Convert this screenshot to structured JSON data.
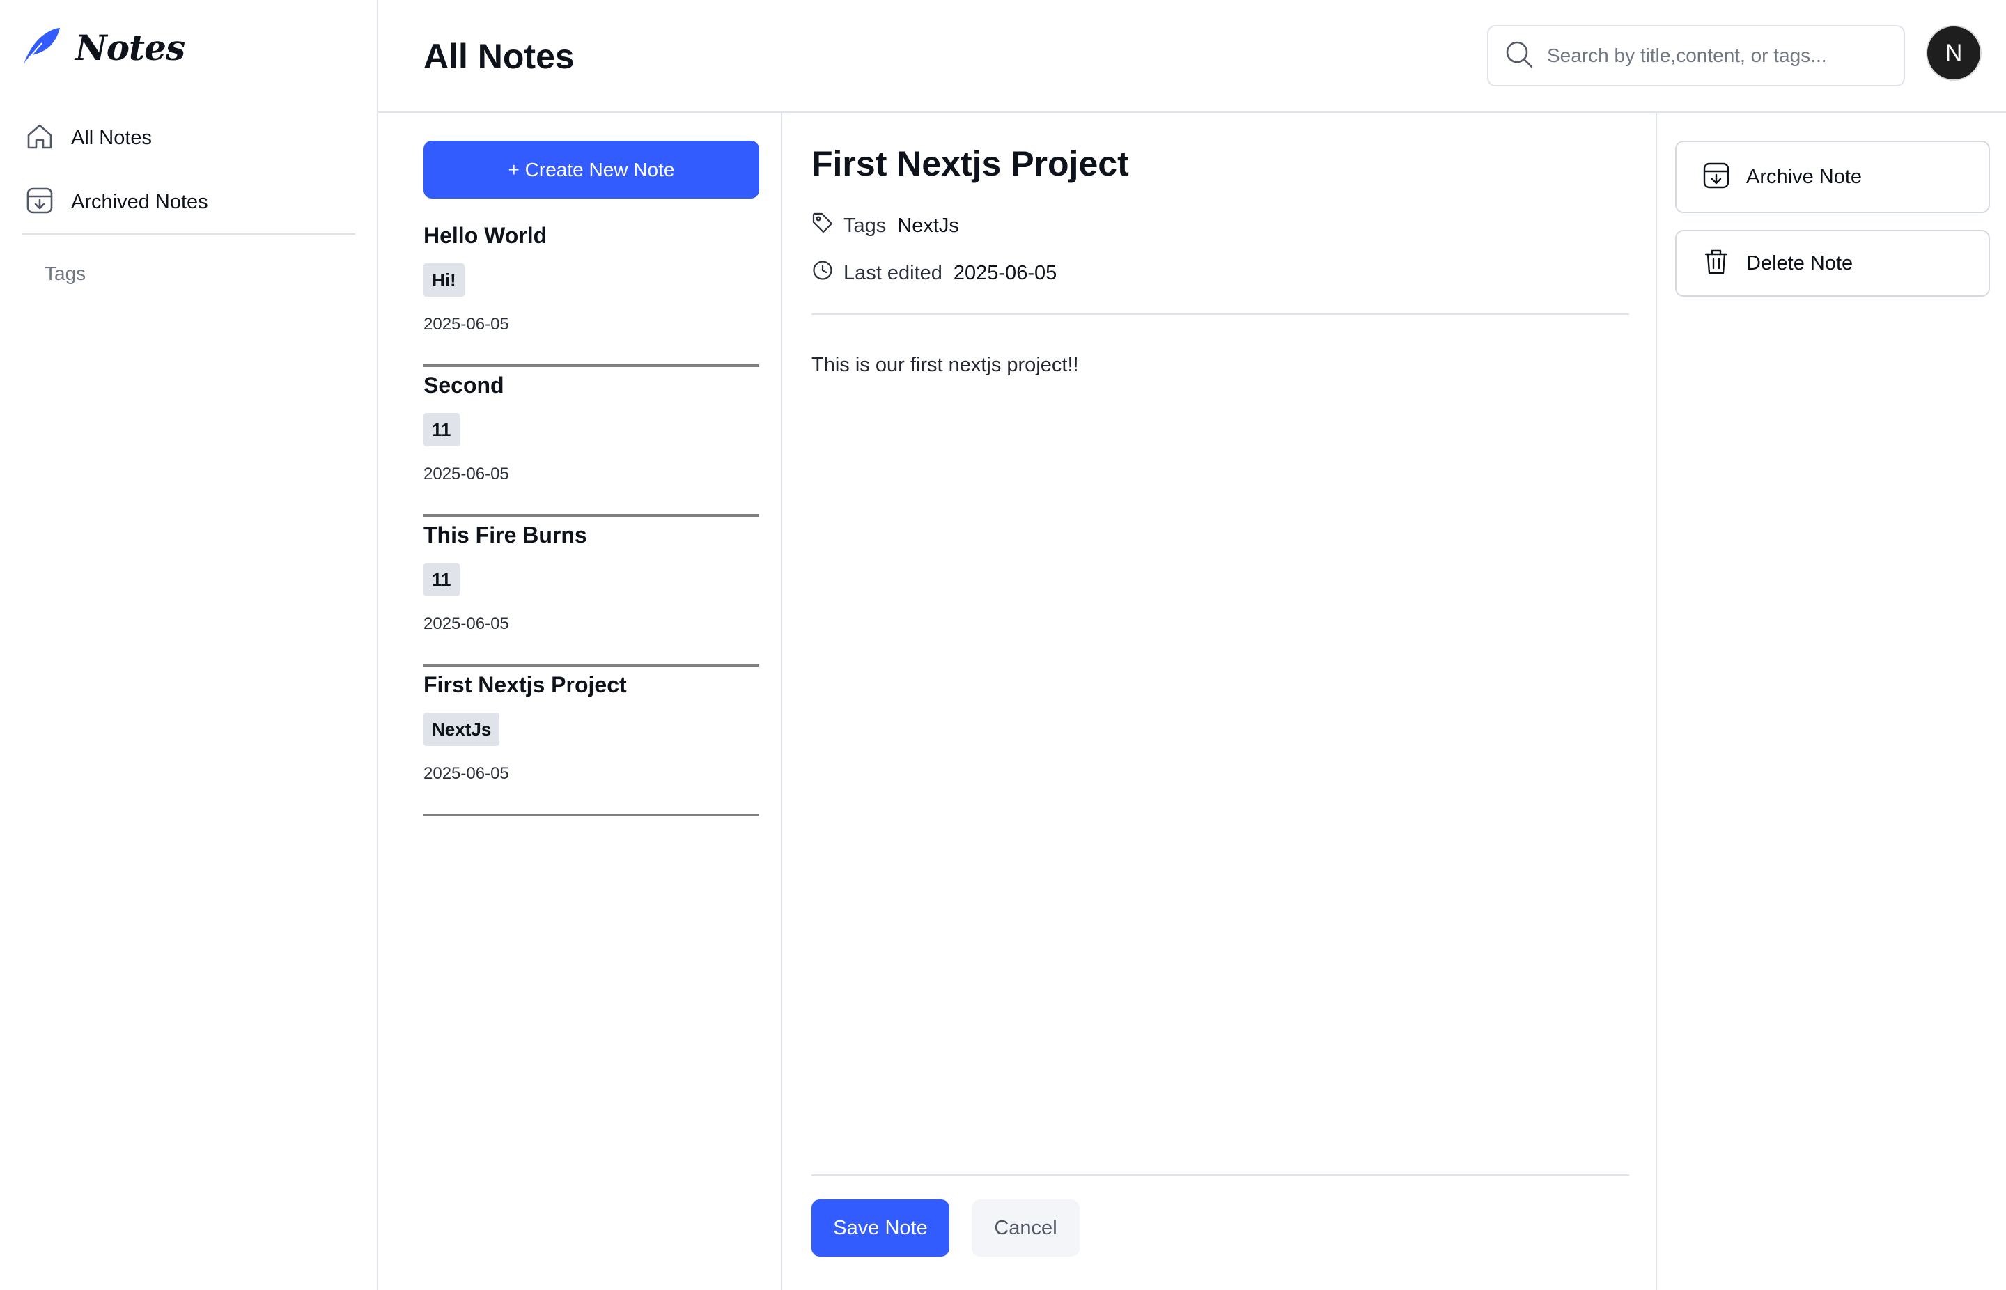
{
  "app": {
    "name": "Notes"
  },
  "sidebar": {
    "items": [
      {
        "label": "All Notes",
        "icon": "home-icon"
      },
      {
        "label": "Archived Notes",
        "icon": "archive-icon"
      }
    ],
    "tags_heading": "Tags"
  },
  "header": {
    "title": "All Notes",
    "search_placeholder": "Search by title,content, or tags...",
    "avatar_initial": "N"
  },
  "list": {
    "create_label": "+ Create New Note",
    "notes": [
      {
        "title": "Hello World",
        "tag": "Hi!",
        "date": "2025-06-05"
      },
      {
        "title": "Second",
        "tag": "11",
        "date": "2025-06-05"
      },
      {
        "title": "This Fire Burns",
        "tag": "11",
        "date": "2025-06-05"
      },
      {
        "title": "First Nextjs Project",
        "tag": "NextJs",
        "date": "2025-06-05"
      }
    ]
  },
  "detail": {
    "title": "First Nextjs Project",
    "tags_label": "Tags",
    "tags_value": "NextJs",
    "edited_label": "Last edited",
    "edited_value": "2025-06-05",
    "body": "This is our first nextjs project!!",
    "save_label": "Save Note",
    "cancel_label": "Cancel"
  },
  "actions": {
    "archive_label": "Archive Note",
    "delete_label": "Delete Note"
  },
  "colors": {
    "accent": "#335cff",
    "text": "#0e121b",
    "muted": "#717784",
    "border": "#e0e4ea",
    "tag_bg": "#e0e4ea",
    "avatar_bg": "#1e1e1e"
  }
}
